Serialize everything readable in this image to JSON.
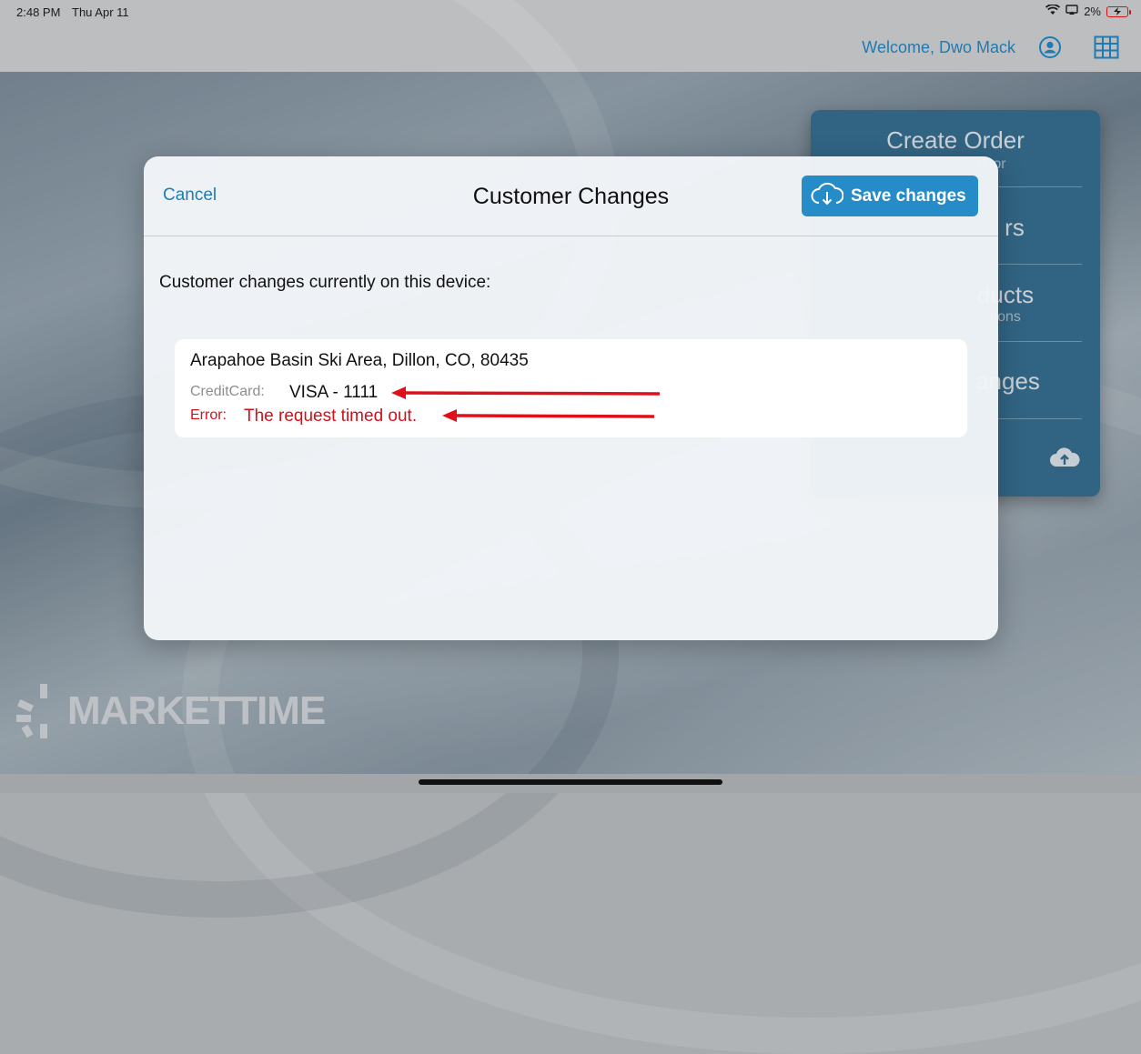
{
  "status_bar": {
    "time": "2:48 PM",
    "date": "Thu Apr 11",
    "battery": "2%"
  },
  "nav": {
    "welcome": "Welcome, Dwo Mack",
    "icons": [
      "account-icon",
      "catalog-grid-icon"
    ]
  },
  "side_menu": {
    "items": [
      {
        "title": "Create Order",
        "subtitle": "ditor"
      },
      {
        "title": "rs",
        "subtitle": ""
      },
      {
        "title": "ducts",
        "subtitle": "tions"
      },
      {
        "title": "anges",
        "subtitle": ""
      }
    ],
    "upload_icon": "cloud-upload-icon"
  },
  "modal": {
    "cancel_label": "Cancel",
    "title": "Customer Changes",
    "save_label": "Save changes",
    "save_icon": "cloud-download-icon",
    "section_label": "Customer changes currently on this device:",
    "changes": [
      {
        "address": "Arapahoe Basin Ski Area, Dillon, CO, 80435",
        "field_label": "CreditCard:",
        "field_value": "VISA - 1111",
        "error_label": "Error:",
        "error_value": "The request timed out."
      }
    ]
  },
  "logo": {
    "text": "MARKETTIME"
  },
  "colors": {
    "accent": "#268cc8",
    "link": "#1f7bb4",
    "error": "#d0121b",
    "menu_panel": "#2f6d93"
  }
}
